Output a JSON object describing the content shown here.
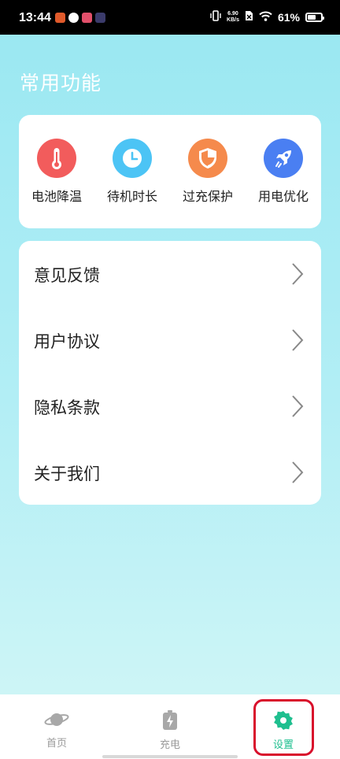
{
  "status_bar": {
    "time": "13:44",
    "net_speed_value": "6.90",
    "net_speed_unit": "KB/s",
    "battery_percent": "61%",
    "battery_level": 0.61
  },
  "section_title": "常用功能",
  "functions": [
    {
      "label": "电池降温",
      "icon": "thermometer-icon",
      "color": "#f25c5c"
    },
    {
      "label": "待机时长",
      "icon": "clock-icon",
      "color": "#4cc4f5"
    },
    {
      "label": "过充保护",
      "icon": "shield-icon",
      "color": "#f58a4c"
    },
    {
      "label": "用电优化",
      "icon": "rocket-icon",
      "color": "#4a7ff2"
    }
  ],
  "menu": [
    {
      "label": "意见反馈"
    },
    {
      "label": "用户协议"
    },
    {
      "label": "隐私条款"
    },
    {
      "label": "关于我们"
    }
  ],
  "bottom_nav": {
    "items": [
      {
        "label": "首页",
        "icon": "planet-icon",
        "active": false
      },
      {
        "label": "充电",
        "icon": "battery-charge-icon",
        "active": false
      },
      {
        "label": "设置",
        "icon": "settings-gear-icon",
        "active": true
      }
    ],
    "active_color": "#1fbf8f",
    "inactive_color": "#9a9a9a"
  }
}
